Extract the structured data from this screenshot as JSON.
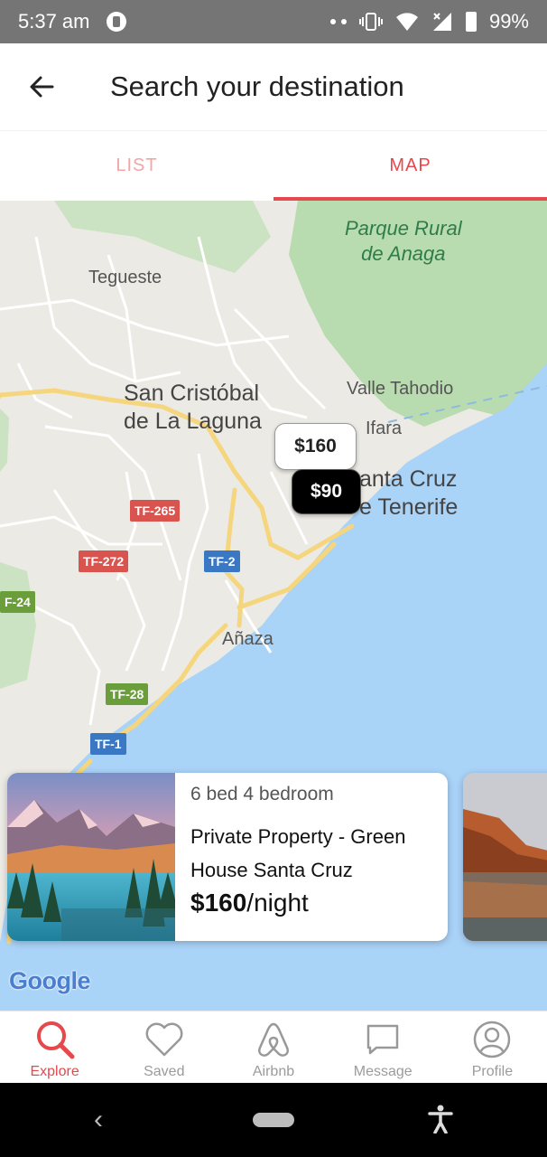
{
  "status_bar": {
    "time": "5:37 am",
    "battery": "99%"
  },
  "header": {
    "title": "Search your destination"
  },
  "tabs": [
    {
      "label": "LIST",
      "active": false
    },
    {
      "label": "MAP",
      "active": true
    }
  ],
  "map": {
    "labels": {
      "tegueste": "Tegueste",
      "park_line1": "Parque Rural",
      "park_line2": "de Anaga",
      "laguna_line1": "San Cristóbal",
      "laguna_line2": "de La Laguna",
      "valle": "Valle Tahodio",
      "ifara": "Ifara",
      "santa_cruz_line1": "anta Cruz",
      "santa_cruz_line2": "e Tenerife",
      "anaza": "Añaza"
    },
    "roads": {
      "tf265": "TF-265",
      "tf272": "TF-272",
      "tf2": "TF-2",
      "tf24": "F-24",
      "tf28": "TF-28",
      "tf1": "TF-1"
    },
    "markers": [
      {
        "label": "$160",
        "selected": false
      },
      {
        "label": "$90",
        "selected": true
      }
    ],
    "attribution": "Google"
  },
  "listing": {
    "beds": "6 bed 4 bedroom",
    "title": "Private Property - Green House Santa Cruz",
    "price": "$160",
    "price_unit": "/night"
  },
  "bottom_nav": [
    {
      "label": "Explore",
      "icon": "search-icon",
      "active": true
    },
    {
      "label": "Saved",
      "icon": "heart-icon",
      "active": false
    },
    {
      "label": "Airbnb",
      "icon": "airbnb-logo-icon",
      "active": false
    },
    {
      "label": "Message",
      "icon": "message-icon",
      "active": false
    },
    {
      "label": "Profile",
      "icon": "profile-icon",
      "active": false
    }
  ],
  "colors": {
    "accent": "#e5484d",
    "accent_light": "#f3a5a7",
    "water": "#aad3f8",
    "park": "#b9dbb0"
  }
}
